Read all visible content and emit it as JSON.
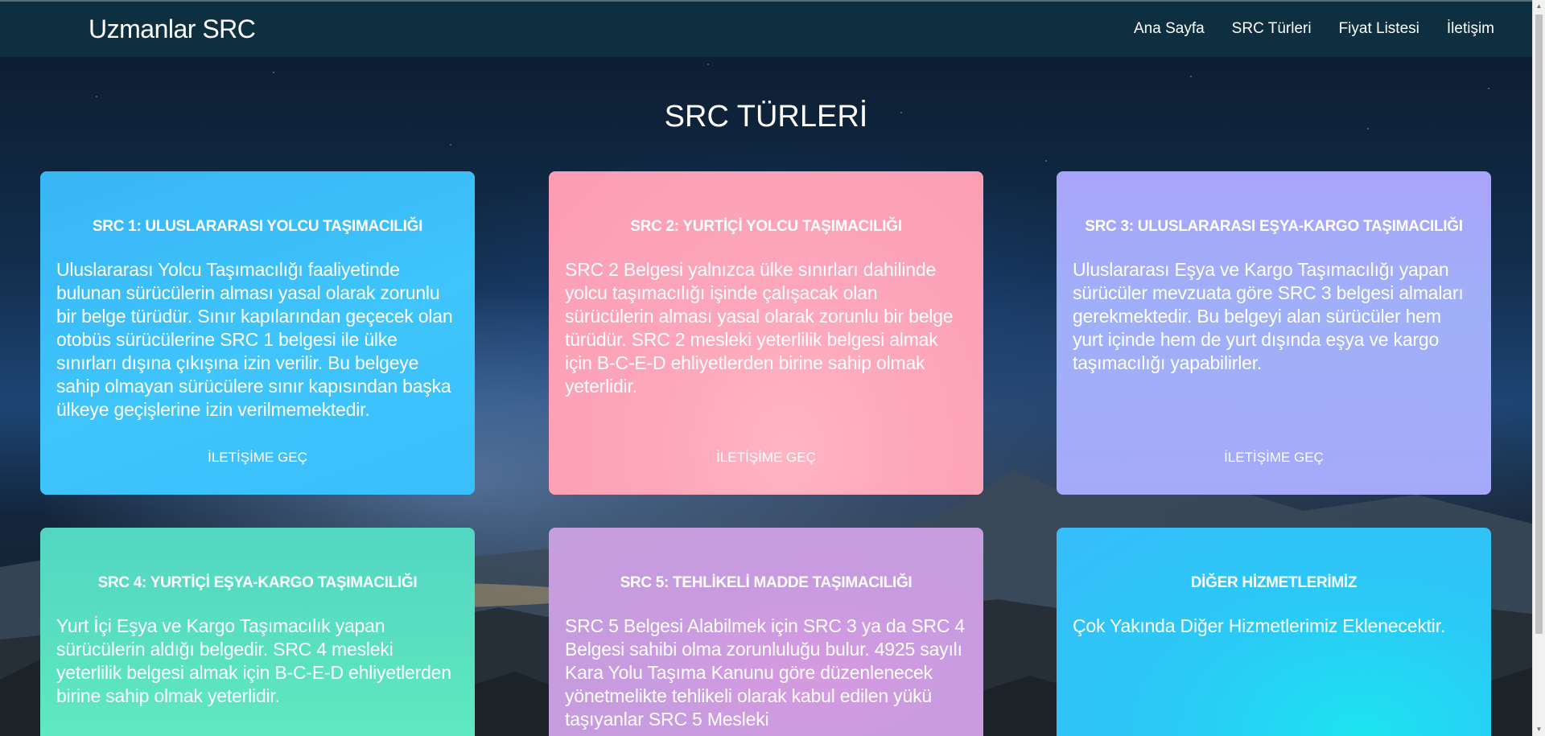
{
  "header": {
    "brand": "Uzmanlar SRC",
    "nav": [
      {
        "label": "Ana Sayfa"
      },
      {
        "label": "SRC Türleri"
      },
      {
        "label": "Fiyat Listesi"
      },
      {
        "label": "İletişim"
      }
    ]
  },
  "section": {
    "title": "SRC TÜRLERİ"
  },
  "cards": [
    {
      "title": "SRC 1: ULUSLARARASI YOLCU TAŞIMACILIĞI",
      "text": "Uluslararası Yolcu Taşımacılığı faaliyetinde bulunan sürücülerin alması yasal olarak zorunlu bir belge türüdür. Sınır kapılarından geçecek olan otobüs sürücülerine SRC 1 belgesi ile ülke sınırları dışına çıkışına izin verilir. Bu belgeye sahip olmayan sürücülere sınır kapısından başka ülkeye geçişlerine izin verilmemektedir.",
      "cta": "İLETİŞİME GEÇ"
    },
    {
      "title": "SRC 2: YURTİÇİ YOLCU TAŞIMACILIĞI",
      "text": "SRC 2 Belgesi yalnızca ülke sınırları dahilinde yolcu taşımacılığı işinde çalışacak olan sürücülerin alması yasal olarak zorunlu bir belge türüdür. SRC 2 mesleki yeterlilik belgesi almak için B-C-E-D ehliyetlerden birine sahip olmak yeterlidir.",
      "cta": "İLETİŞİME GEÇ"
    },
    {
      "title": "SRC 3: ULUSLARARASI EŞYA-KARGO TAŞIMACILIĞI",
      "text": "Uluslararası Eşya ve Kargo Taşımacılığı yapan sürücüler mevzuata göre SRC 3 belgesi almaları gerekmektedir. Bu belgeyi alan sürücüler hem yurt içinde hem de yurt dışında eşya ve kargo taşımacılığı yapabilirler.",
      "cta": "İLETİŞİME GEÇ"
    },
    {
      "title": "SRC 4: YURTİÇİ EŞYA-KARGO TAŞIMACILIĞI",
      "text": "Yurt İçi Eşya ve Kargo Taşımacılık yapan sürücülerin aldığı belgedir. SRC 4 mesleki yeterlilik belgesi almak için B-C-E-D ehliyetlerden birine sahip olmak yeterlidir."
    },
    {
      "title": "SRC 5: TEHLİKELİ MADDE TAŞIMACILIĞI",
      "text": "SRC 5 Belgesi Alabilmek için SRC 3 ya da SRC 4 Belgesi sahibi olma zorunluluğu bulur. 4925 sayılı Kara Yolu Taşıma Kanunu göre düzenlenecek yönetmelikte tehlikeli olarak kabul edilen yükü taşıyanlar SRC 5 Mesleki"
    },
    {
      "title": "DİĞER HİZMETLERİMİZ",
      "text": "Çok Yakında Diğer Hizmetlerimiz Eklenecektir."
    }
  ]
}
